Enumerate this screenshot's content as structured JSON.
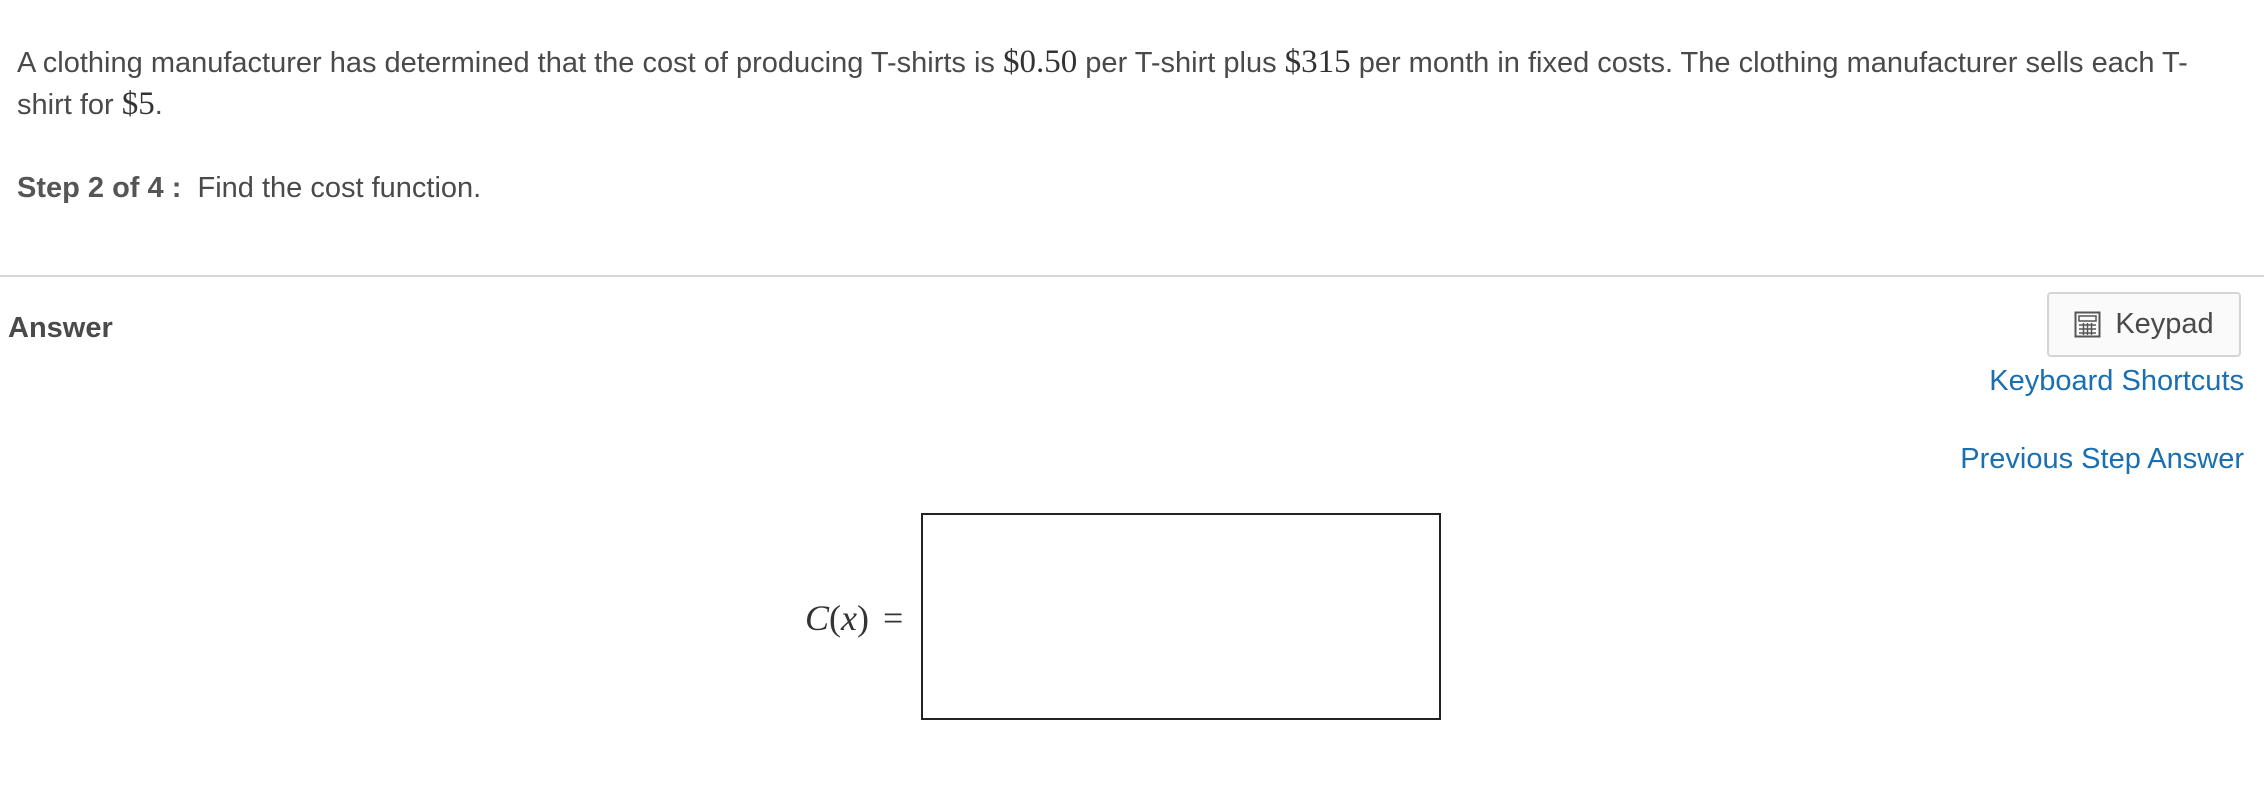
{
  "problem": {
    "text_1": "A clothing manufacturer has determined that the cost of producing T-shirts is ",
    "math_1": "$0.50",
    "text_2": " per T-shirt plus ",
    "math_2": "$315",
    "text_3": " per month in fixed costs.  The clothing manufacturer sells each T-shirt for ",
    "math_3": "$5",
    "text_4": "."
  },
  "step": {
    "label": "Step 2 of 4 :",
    "instruction": "Find the cost function."
  },
  "answer": {
    "heading": "Answer",
    "keypad_label": "Keypad",
    "keyboard_shortcuts_link": "Keyboard Shortcuts",
    "previous_step_link": "Previous Step Answer",
    "function_name": "C",
    "function_open": "(",
    "function_var": "x",
    "function_close": ")",
    "equals": "=",
    "input_value": "",
    "input_placeholder": ""
  },
  "icons": {
    "keypad": "calculator-icon"
  },
  "colors": {
    "link": "#1a6fb0",
    "text": "#4a4a4a",
    "divider": "#d6d6d6",
    "input_border": "#222222"
  }
}
